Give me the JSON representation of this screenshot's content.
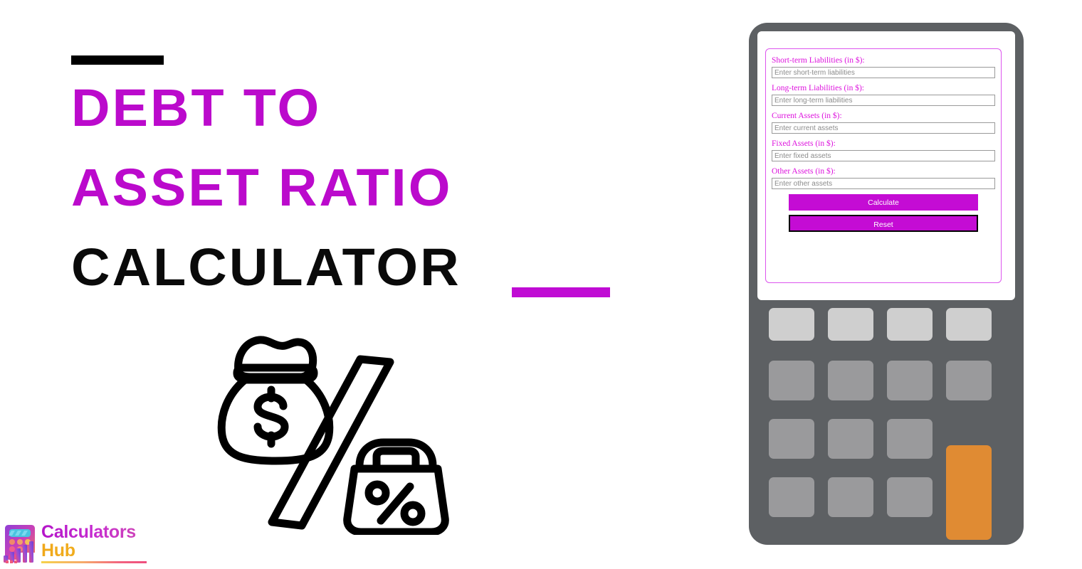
{
  "hero": {
    "title_lines": [
      "DEBT TO",
      "ASSET RATIO",
      "CALCULATOR"
    ],
    "accent_color": "#bb0acc",
    "dark_color": "#0a0a0a",
    "rule_top_color": "#000000",
    "rule_bottom_color": "#c00cd4",
    "icon_name": "money-bag-percent-bag-icon"
  },
  "logo": {
    "word1": "Calculators",
    "word2": "Hub",
    "word1_color": "#b415c9",
    "word2_color": "#f0a81a",
    "mark_name": "calculator-bars-logo-icon"
  },
  "calculator": {
    "frame_color": "#5d6063",
    "screen_color": "#ffffff",
    "form_border_color": "#dd55ee",
    "form": {
      "fields": [
        {
          "label": "Short-term Liabilities (in $):",
          "placeholder": "Enter short-term liabilities",
          "value": "",
          "name": "short-term-liabilities-input"
        },
        {
          "label": "Long-term Liabilities (in $):",
          "placeholder": "Enter long-term liabilities",
          "value": "",
          "name": "long-term-liabilities-input"
        },
        {
          "label": "Current Assets (in $):",
          "placeholder": "Enter current assets",
          "value": "",
          "name": "current-assets-input"
        },
        {
          "label": "Fixed Assets (in $):",
          "placeholder": "Enter fixed assets",
          "value": "",
          "name": "fixed-assets-input"
        },
        {
          "label": "Other Assets (in $):",
          "placeholder": "Enter other assets",
          "value": "",
          "name": "other-assets-input"
        }
      ],
      "calculate_label": "Calculate",
      "reset_label": "Reset",
      "button_color": "#c40cd4",
      "button_text_color": "#ffffff",
      "reset_outline_color": "#000000"
    },
    "keypad": {
      "light_key_color": "#cfcfcf",
      "mid_key_color": "#9a9a9c",
      "accent_key_color": "#e08b33",
      "rows": 4,
      "columns": 4
    }
  }
}
